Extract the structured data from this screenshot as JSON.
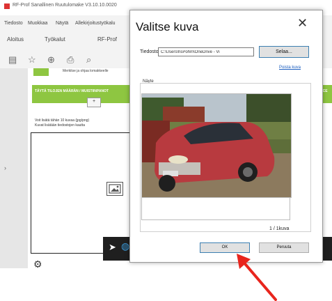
{
  "app": {
    "title": "RF-Prof Sanallinen Ruutulomake V3.10.10.0020",
    "menu": [
      "Tiedosto",
      "Muokkaa",
      "Näytä",
      "Allekirjoitustyökalu"
    ],
    "tabs": [
      "Aloitus",
      "Työkalut",
      "RF-Prof"
    ],
    "toolbar_icons": [
      "sidebar-icon",
      "star-icon",
      "upload-icon",
      "print-icon",
      "search-icon"
    ]
  },
  "document": {
    "row1_text": "Merkitse ja ohjaa lomakkeelle",
    "green_header": "TÄYTÄ TILOJEN MÄÄRÄN / MUISTIINPANOT",
    "green_header_right": "ACE",
    "doc_line1": "Voit lisätä tähän 10 kuvaa (jpg/png)",
    "doc_line2": "Kuvat lisätään tiedostojen kautta",
    "small_button": "+"
  },
  "dialog": {
    "title": "Valitse kuva",
    "file_label": "Tiedosto:",
    "file_value": "C:\\Users\\hsPohm\\OneDrive - Vi",
    "browse_label": "Selaa...",
    "clear_link": "Poista kuva",
    "preview_label": "Näyte",
    "count_label": "1 / 1kuva",
    "ok_label": "OK",
    "cancel_label": "Peruuta"
  },
  "colors": {
    "green": "#8ec641",
    "button_border": "#3c7fb1",
    "arrow": "#e8251d"
  }
}
